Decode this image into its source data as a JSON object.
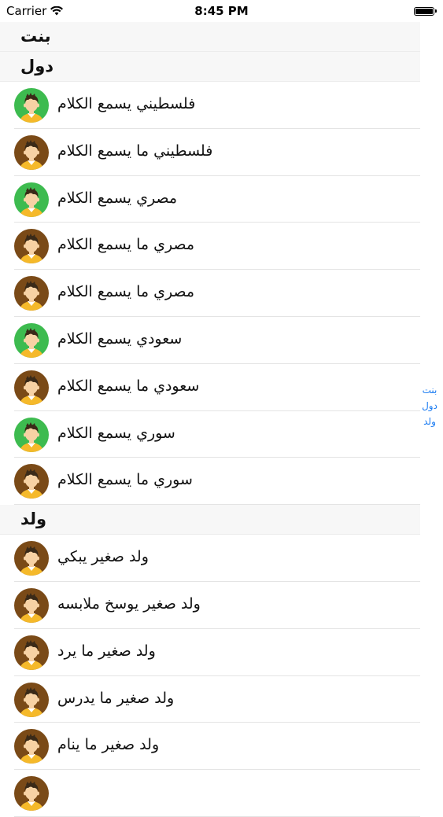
{
  "status_bar": {
    "carrier": "Carrier",
    "time": "8:45 PM",
    "battery_level": 1.0
  },
  "sections": [
    {
      "title": "بنت",
      "rows": []
    },
    {
      "title": "دول",
      "rows": [
        {
          "label": "فلسطيني يسمع الكلام",
          "avatar_bg": "#3dbb4f"
        },
        {
          "label": "فلسطيني  ما يسمع الكلام",
          "avatar_bg": "#7a4a17"
        },
        {
          "label": "مصري يسمع الكلام",
          "avatar_bg": "#3dbb4f"
        },
        {
          "label": "مصري  ما يسمع الكلام",
          "avatar_bg": "#7a4a17"
        },
        {
          "label": "مصري  ما يسمع الكلام",
          "avatar_bg": "#7a4a17"
        },
        {
          "label": "سعودي يسمع الكلام",
          "avatar_bg": "#3dbb4f"
        },
        {
          "label": "سعودي  ما يسمع الكلام",
          "avatar_bg": "#7a4a17"
        },
        {
          "label": "سوري يسمع الكلام",
          "avatar_bg": "#3dbb4f"
        },
        {
          "label": "سوري  ما يسمع الكلام",
          "avatar_bg": "#7a4a17"
        }
      ]
    },
    {
      "title": "ولد",
      "rows": [
        {
          "label": "ولد صغير يبكي",
          "avatar_bg": "#7a4a17"
        },
        {
          "label": "ولد صغير يوسخ ملابسه",
          "avatar_bg": "#7a4a17"
        },
        {
          "label": "ولد صغير ما يرد",
          "avatar_bg": "#7a4a17"
        },
        {
          "label": "ولد صغير ما يدرس",
          "avatar_bg": "#7a4a17"
        },
        {
          "label": "ولد صغير ما ينام",
          "avatar_bg": "#7a4a17"
        },
        {
          "label": "",
          "avatar_bg": "#7a4a17"
        }
      ]
    }
  ],
  "index_bar": [
    "بنت",
    "دول",
    "ولد"
  ],
  "colors": {
    "accent": "#1a7bf2",
    "avatar_green": "#3dbb4f",
    "avatar_brown": "#7a4a17",
    "shirt": "#f5b92a",
    "hair": "#3a2a18",
    "skin": "#f7d2a4"
  }
}
